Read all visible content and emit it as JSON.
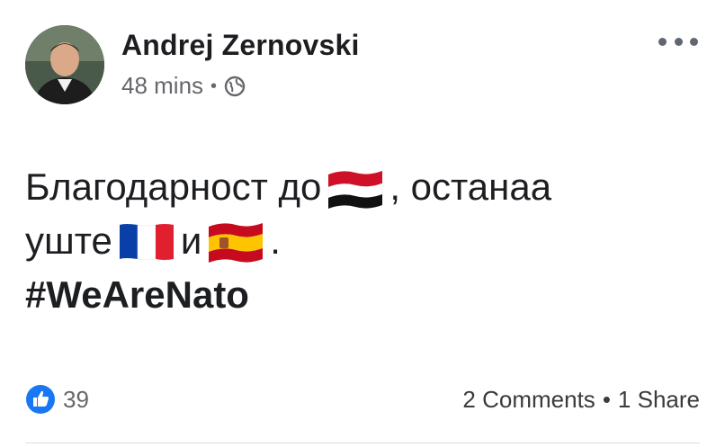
{
  "post": {
    "author": "Andrej Zernovski",
    "time": "48 mins",
    "separator": "•",
    "text_line1_a": "Благодарност до",
    "text_line1_b": ", останаа",
    "text_line2_a": "уште",
    "text_line2_b": "и",
    "text_line2_c": ".",
    "hashtag": "#WeAreNato"
  },
  "icons": {
    "privacy": "globe-icon",
    "more": "more-options-icon",
    "reaction": "like-icon",
    "flags": [
      "flag-egypt-icon",
      "flag-france-icon",
      "flag-spain-icon"
    ]
  },
  "footer": {
    "likes": "39",
    "comments": "2 Comments",
    "separator": "•",
    "shares": "1 Share"
  },
  "colors": {
    "accent": "#1877f2",
    "text": "#1c1e21",
    "muted": "#65676b"
  }
}
